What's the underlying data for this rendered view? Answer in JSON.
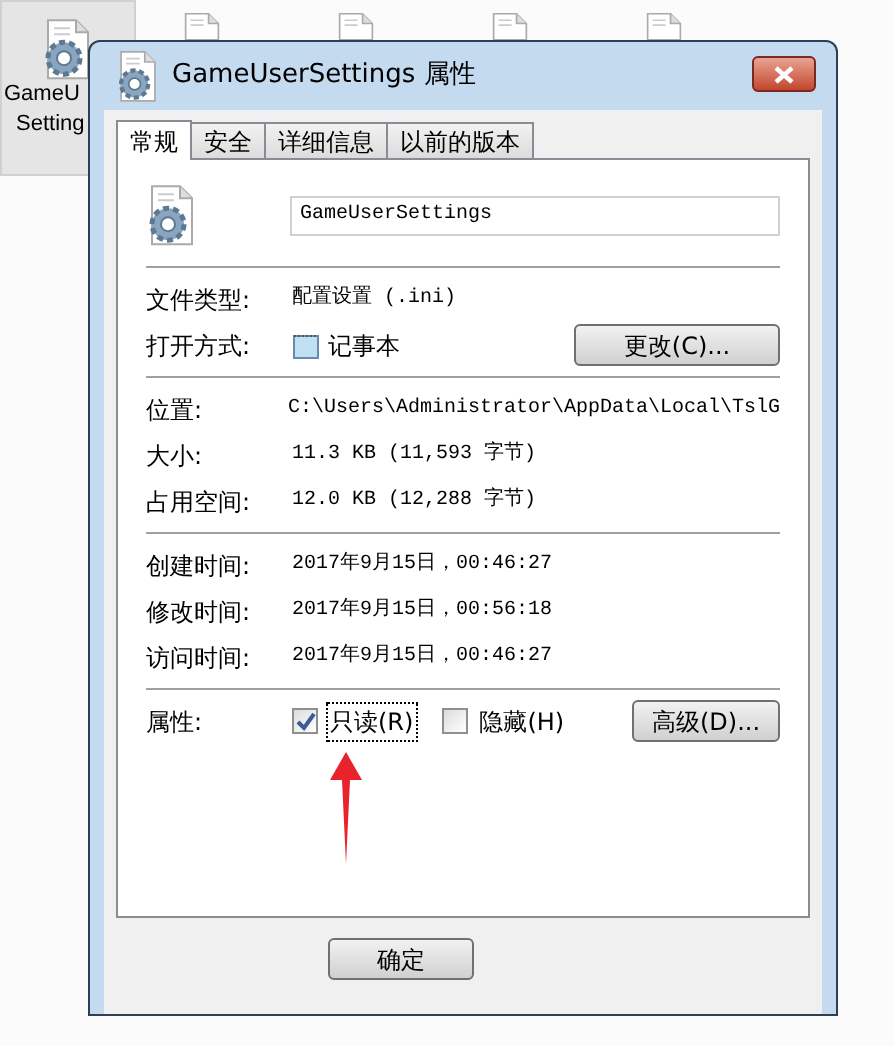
{
  "desktop": {
    "selected_icon": {
      "label_lines": [
        "GameU",
        "Setting"
      ],
      "selected": true
    }
  },
  "window": {
    "title": "GameUserSettings 属性"
  },
  "tabs": [
    {
      "label": "常规",
      "selected": true
    },
    {
      "label": "安全",
      "selected": false
    },
    {
      "label": "详细信息",
      "selected": false
    },
    {
      "label": "以前的版本",
      "selected": false
    }
  ],
  "file_name": {
    "value": "GameUserSettings"
  },
  "sections": [
    {
      "rows": [
        {
          "kind": "text",
          "label": "文件类型:",
          "value": "配置设置 (.ini)"
        },
        {
          "kind": "app",
          "label": "打开方式:",
          "value": "记事本",
          "button": "更改(C)..."
        }
      ]
    },
    {
      "rows": [
        {
          "kind": "text",
          "label": "位置:",
          "value": "C:\\Users\\Administrator\\AppData\\Local\\TslG"
        },
        {
          "kind": "text",
          "label": "大小:",
          "value": "11.3 KB (11,593 字节)"
        },
        {
          "kind": "text",
          "label": "占用空间:",
          "value": "12.0 KB (12,288 字节)"
        }
      ]
    },
    {
      "rows": [
        {
          "kind": "text",
          "label": "创建时间:",
          "value": "2017年9月15日，00:46:27"
        },
        {
          "kind": "text",
          "label": "修改时间:",
          "value": "2017年9月15日，00:56:18"
        },
        {
          "kind": "text",
          "label": "访问时间:",
          "value": "2017年9月15日，00:46:27"
        }
      ]
    },
    {
      "rows": [
        {
          "kind": "attributes",
          "label": "属性:",
          "checkboxes": [
            {
              "label": "只读(R)",
              "checked": true,
              "focused": true
            },
            {
              "label": "隐藏(H)",
              "checked": false,
              "focused": false
            }
          ],
          "button": "高级(D)..."
        }
      ]
    }
  ],
  "buttons": [
    "确定"
  ]
}
